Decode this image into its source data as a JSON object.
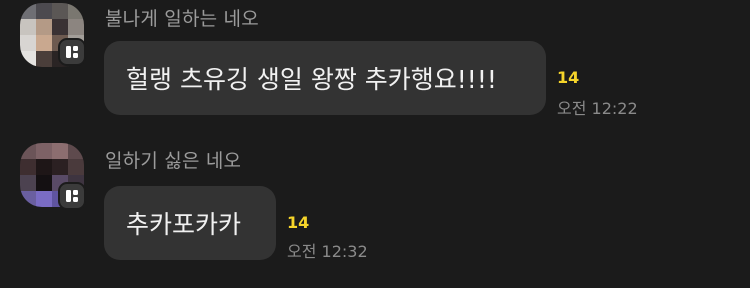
{
  "messages": [
    {
      "sender": "불나게 일하는 네오",
      "text": "헐랭 츠유깅 생일 왕짱 추카행요!!!!",
      "unread_count": "14",
      "time": "오전 12:22",
      "avatar_icon": "blurred-profile-photo",
      "badge_icon": "multi-profile-icon"
    },
    {
      "sender": "일하기 싫은 네오",
      "text": "추카포카카",
      "unread_count": "14",
      "time": "오전 12:32",
      "avatar_icon": "blurred-profile-photo",
      "badge_icon": "multi-profile-icon"
    }
  ],
  "colors": {
    "background": "#1b1b1b",
    "bubble": "#333333",
    "unread": "#f5d42a",
    "sender_text": "#9b9b9b",
    "time_text": "#8a8a8a"
  }
}
